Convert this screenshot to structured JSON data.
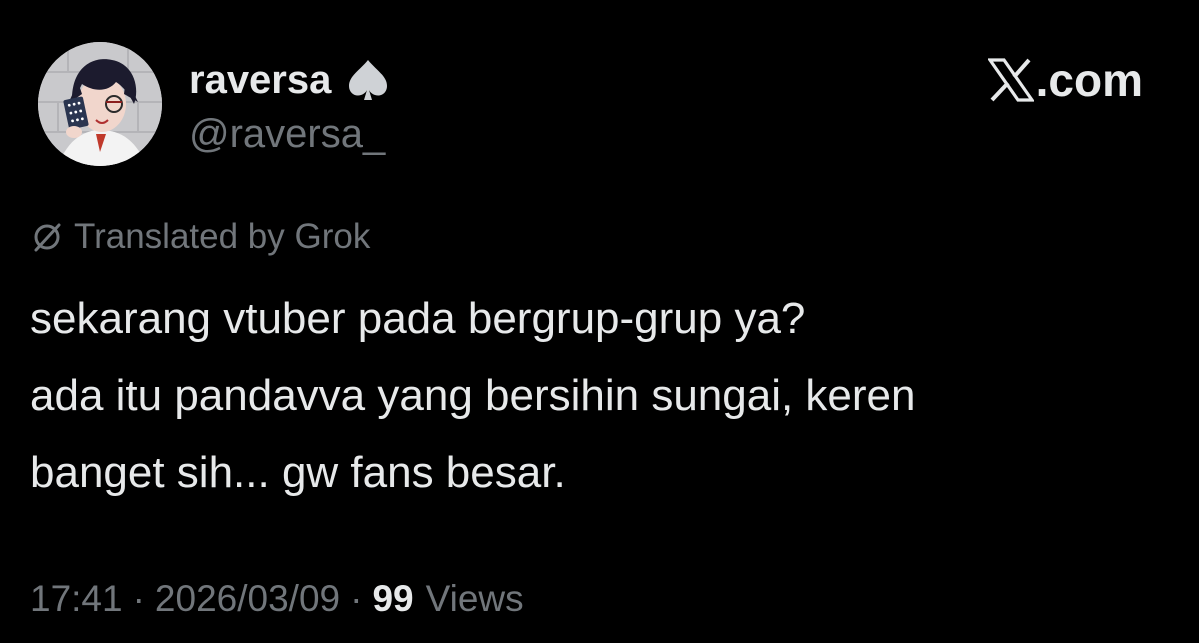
{
  "author": {
    "display_name": "raversa",
    "handle": "@raversa_",
    "avatar_icon": "avatar-image",
    "badge_icon": "spade-icon"
  },
  "brand": {
    "logo_icon": "x-logo-icon",
    "text": ".com"
  },
  "translation": {
    "icon": "translate-icon",
    "label": "Translated by Grok"
  },
  "tweet": {
    "lines": [
      "sekarang vtuber pada bergrup-grup ya?",
      "ada itu pandavva yang bersihin sungai, keren",
      "banget sih... gw fans besar."
    ]
  },
  "meta": {
    "time": "17:41",
    "separator": "·",
    "date": "2026/03/09",
    "views_count": "99",
    "views_label": "Views"
  },
  "colors": {
    "background": "#000000",
    "primary_text": "#e7e9ea",
    "secondary_text": "#71767b"
  }
}
